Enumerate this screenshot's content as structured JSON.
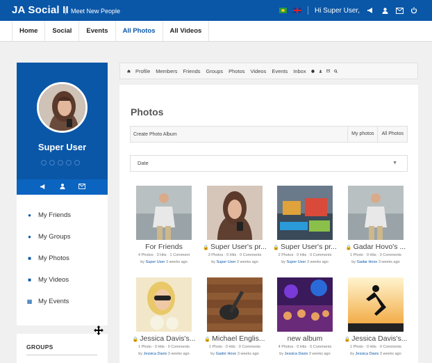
{
  "header": {
    "brand": "JA Social II",
    "tagline": "Meet New People",
    "greeting": "Hi Super User,"
  },
  "nav": [
    "Home",
    "Social",
    "Events",
    "All Photos",
    "All Videos"
  ],
  "nav_active": "All Photos",
  "profile": {
    "name": "Super User"
  },
  "side_menu": [
    "My Friends",
    "My Groups",
    "My Photos",
    "My Videos",
    "My Events"
  ],
  "groups_title": "GROUPS",
  "jsnav": [
    "Profile",
    "Members",
    "Friends",
    "Groups",
    "Photos",
    "Videos",
    "Events",
    "Inbox"
  ],
  "page_title": "Photos",
  "album_bar": {
    "create": "Create Photo Album",
    "my": "My photos",
    "all": "All Photos"
  },
  "sort": {
    "value": "Date"
  },
  "albums": [
    {
      "title": "For Friends",
      "locked": false,
      "meta": "4 Photos · 3 Hits · 1 Comment",
      "by": "by",
      "user": "Super User",
      "when": "3 weeks ago"
    },
    {
      "title": "Super User's pr...",
      "locked": true,
      "meta": "3 Photos · 0 Hits · 0 Comments",
      "by": "by",
      "user": "Super User",
      "when": "3 weeks ago"
    },
    {
      "title": "Super User's pr...",
      "locked": true,
      "meta": "2 Photos · 0 Hits · 0 Comments",
      "by": "by",
      "user": "Super User",
      "when": "3 weeks ago"
    },
    {
      "title": "Gadar Hovo's ...",
      "locked": true,
      "meta": "1 Photo · 0 Hits · 0 Comments",
      "by": "by",
      "user": "Gadar Hovo",
      "when": "3 weeks ago"
    },
    {
      "title": "Jessica Davis's...",
      "locked": true,
      "meta": "1 Photo · 0 Hits · 0 Comments",
      "by": "by",
      "user": "Jessica Davis",
      "when": "3 weeks ago"
    },
    {
      "title": "Michael Englis...",
      "locked": true,
      "meta": "1 Photo · 0 Hits · 0 Comments",
      "by": "by",
      "user": "Gador Hovo",
      "when": "3 weeks ago"
    },
    {
      "title": "new album",
      "locked": false,
      "meta": "4 Photos · 0 Hits · 0 Comments",
      "by": "by",
      "user": "Jessica Davis",
      "when": "3 weeks ago"
    },
    {
      "title": "Jessica Davis's...",
      "locked": true,
      "meta": "1 Photo · 0 Hits · 0 Comments",
      "by": "by",
      "user": "Jessica Davis",
      "when": "3 weeks ago"
    }
  ],
  "colors": {
    "brand": "#0a57a8",
    "link": "#0a57a8"
  }
}
